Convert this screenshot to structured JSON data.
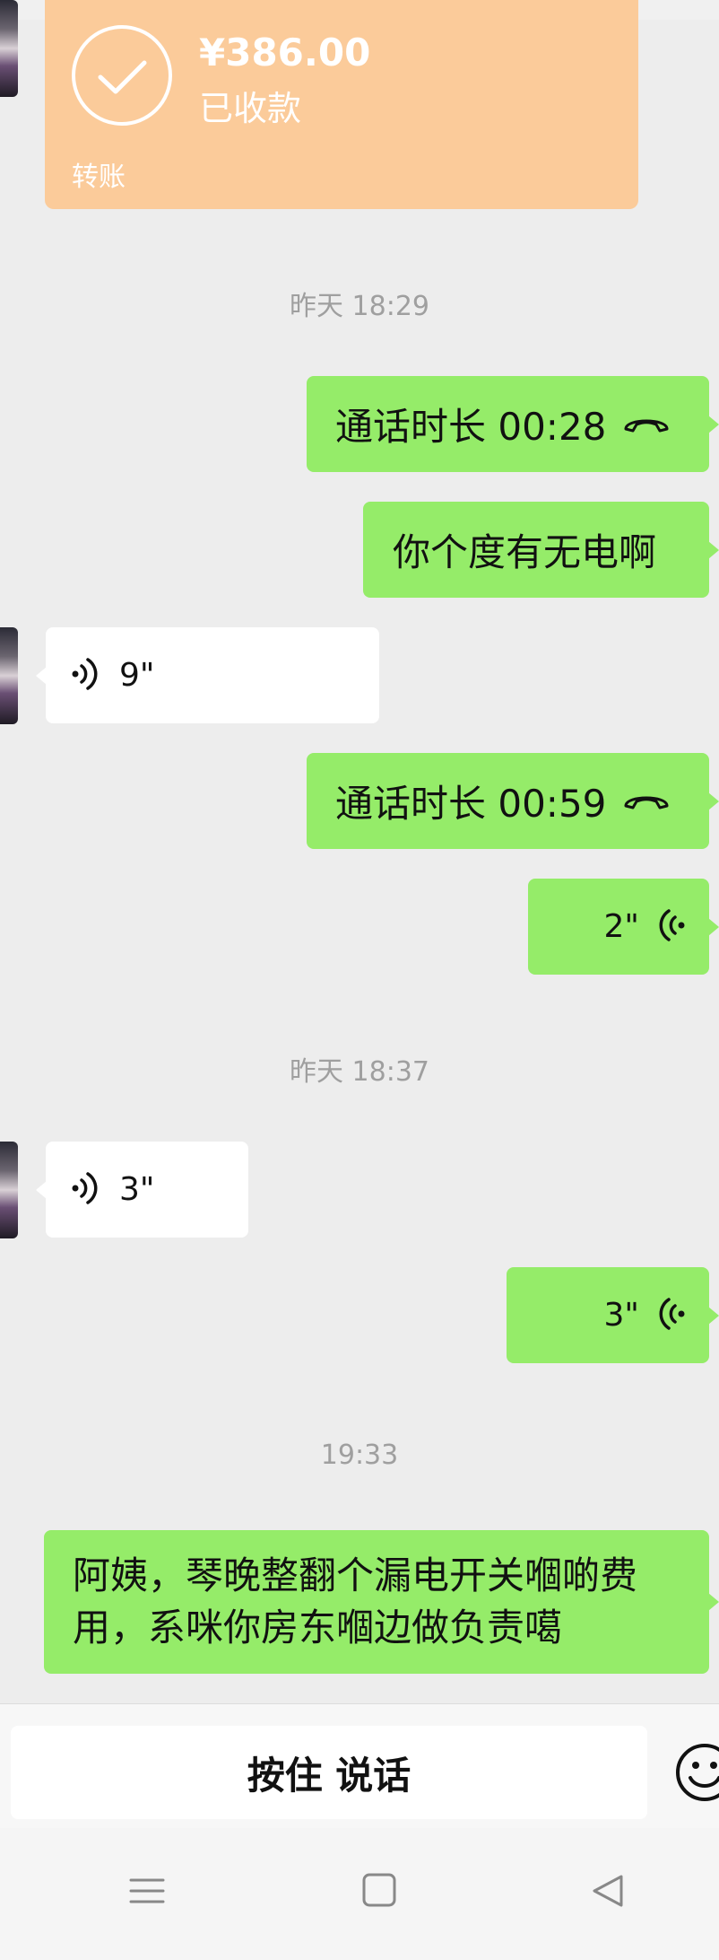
{
  "transfer": {
    "amount": "¥386.00",
    "status": "已收款",
    "type_label": "转账",
    "color": "#fbcb9a"
  },
  "timestamps": [
    "昨天 18:29",
    "昨天 18:37",
    "19:33"
  ],
  "messages": {
    "call1": "通话时长 00:28",
    "text1": "你个度有无电啊",
    "voice_in_1": "9\"",
    "call2": "通话时长 00:59",
    "voice_out_1": "2\"",
    "voice_in_2": "3\"",
    "voice_out_2": "3\"",
    "long_line1": "阿姨，琴晚整翻个漏电开关嗰啲费",
    "long_line2": "用，系咪你房东嗰边做负责噶"
  },
  "input_bar": {
    "hold_to_talk": "按住 说话",
    "emoji_icon": "smiley-icon"
  },
  "nav": {
    "menu_icon": "menu-icon",
    "home_icon": "home-icon",
    "back_icon": "back-icon"
  },
  "colors": {
    "bubble_out": "#95ec69",
    "bubble_in": "#ffffff",
    "bg": "#ededed"
  }
}
